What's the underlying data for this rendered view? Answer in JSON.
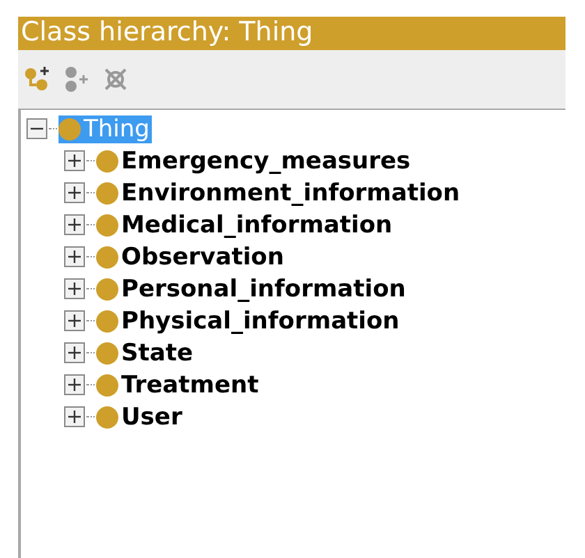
{
  "panel": {
    "title": "Class hierarchy: Thing"
  },
  "tree": [
    {
      "label": "Thing",
      "expanded": true,
      "selected": true,
      "children": [
        {
          "label": "Emergency_measures",
          "expanded": false,
          "selected": false
        },
        {
          "label": "Environment_information",
          "expanded": false,
          "selected": false
        },
        {
          "label": "Medical_information",
          "expanded": false,
          "selected": false
        },
        {
          "label": "Observation",
          "expanded": false,
          "selected": false
        },
        {
          "label": "Personal_information",
          "expanded": false,
          "selected": false
        },
        {
          "label": "Physical_information",
          "expanded": false,
          "selected": false
        },
        {
          "label": "State",
          "expanded": false,
          "selected": false
        },
        {
          "label": "Treatment",
          "expanded": false,
          "selected": false
        },
        {
          "label": "User",
          "expanded": false,
          "selected": false
        }
      ]
    }
  ]
}
